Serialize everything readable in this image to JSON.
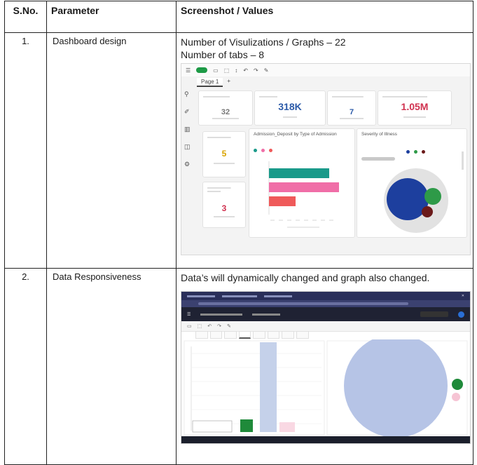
{
  "table": {
    "headers": [
      "S.No.",
      "Parameter",
      "Screenshot / Values"
    ],
    "rows": [
      {
        "sno": "1.",
        "parameter": "Dashboard design",
        "lines": [
          "Number of Visulizations / Graphs – 22",
          "Number of tabs – 8"
        ]
      },
      {
        "sno": "2.",
        "parameter": "Data Responsiveness",
        "lines": [
          "Data’s will dynamically changed and graph also changed."
        ]
      }
    ]
  },
  "dashboard": {
    "tab_label": "Page 1",
    "kpis": [
      {
        "value": "32",
        "color": "#333333"
      },
      {
        "value": "318K",
        "color": "#2b5aa8"
      },
      {
        "value": "7",
        "color": "#2b5aa8"
      },
      {
        "value": "1.05M",
        "color": "#d0314f"
      }
    ],
    "side_kpis": [
      {
        "value": "5",
        "color": "#d8a300"
      },
      {
        "value": "3",
        "color": "#d0314f"
      }
    ],
    "bar_chart_title": "Admission_Deposit by Type of Admission",
    "bubble_chart_title": "Severity of Illness"
  },
  "colors": {
    "teal": "#1a9a8a",
    "pink": "#f06ea7",
    "red": "#ef5a5a",
    "navy": "#1d3f9e",
    "green": "#2e9a48",
    "maroon": "#6b1a1a",
    "lavender": "#b6c4e6"
  }
}
